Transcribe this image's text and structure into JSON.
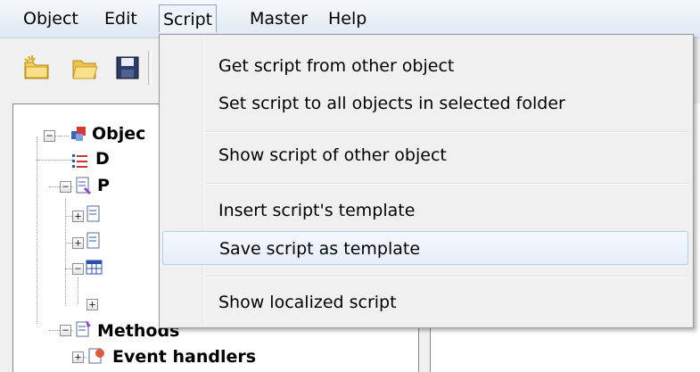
{
  "menubar": {
    "items": [
      {
        "label": "Object"
      },
      {
        "label": "Edit"
      },
      {
        "label": "Script"
      },
      {
        "label": "Master"
      },
      {
        "label": "Help"
      }
    ]
  },
  "toolbar": {
    "buttons": [
      {
        "icon": "new-folder-icon"
      },
      {
        "icon": "open-folder-icon"
      },
      {
        "icon": "save-icon"
      }
    ]
  },
  "tree": {
    "nodes": [
      {
        "label": "Objec",
        "icon": "object-cubes-icon",
        "expander": "−"
      },
      {
        "label": "D",
        "icon": "list-icon"
      },
      {
        "label": "P",
        "icon": "properties-icon",
        "expander": "−"
      },
      {
        "label": "",
        "icon": "property-item-icon",
        "expander": "+"
      },
      {
        "label": "",
        "icon": "property-item-icon",
        "expander": "+"
      },
      {
        "label": "",
        "icon": "table-icon",
        "expander": "−"
      },
      {
        "label": "",
        "expander": "+"
      },
      {
        "label": "Methods",
        "icon": "methods-icon",
        "expander": "−"
      },
      {
        "label": "Event handlers",
        "icon": "event-handlers-icon",
        "expander": "+"
      }
    ]
  },
  "script_menu": {
    "items": [
      {
        "label": "Get script from other object"
      },
      {
        "label": "Set script to all objects in selected folder"
      },
      {
        "label": "Show script of other object"
      },
      {
        "label": "Insert script's template"
      },
      {
        "label": "Save script as template",
        "highlighted": true
      },
      {
        "label": "Show localized script"
      }
    ]
  },
  "colors": {
    "menu_hover_border": "#aecff7",
    "menubar_bg": "#dfe8f3",
    "window_bg": "#f0f0f0"
  }
}
